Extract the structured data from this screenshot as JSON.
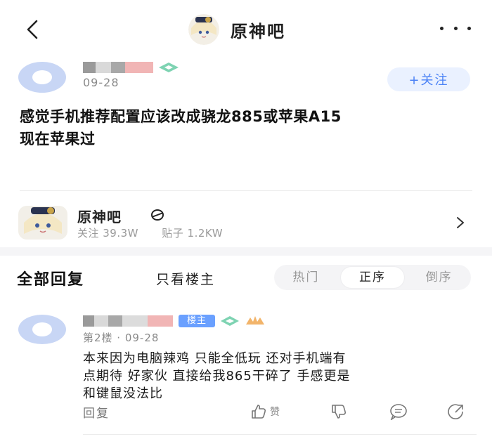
{
  "header": {
    "forum_name": "原神吧",
    "back_icon": "chevron-left-icon",
    "more_icon": "more-horizontal-icon"
  },
  "post": {
    "date": "09-28",
    "follow_label": "+关注",
    "title_line1": "感觉手机推荐配置应该改成骁龙885或苹果A15",
    "title_line2": "现在苹果过"
  },
  "forum_card": {
    "name": "原神吧",
    "followers": "关注 39.3W",
    "posts": "贴子 1.2KW"
  },
  "filters": {
    "all_replies": "全部回复",
    "only_op": "只看楼主",
    "sort_options": [
      "热门",
      "正序",
      "倒序"
    ],
    "active_sort": "正序"
  },
  "reply": {
    "op_badge": "楼主",
    "meta": "第2楼 · 09-28",
    "text_line1": "本来因为电脑辣鸡 只能全低玩 还对手机端有",
    "text_line2": "点期待 好家伙 直接给我865干碎了 手感更是",
    "text_line3": "和键鼠没法比",
    "reply_label": "回复",
    "like_label": "赞"
  },
  "colors": {
    "accent": "#4b82f6",
    "follow_bg": "#eaf1ff",
    "op_badge": "#6aa0ff"
  }
}
